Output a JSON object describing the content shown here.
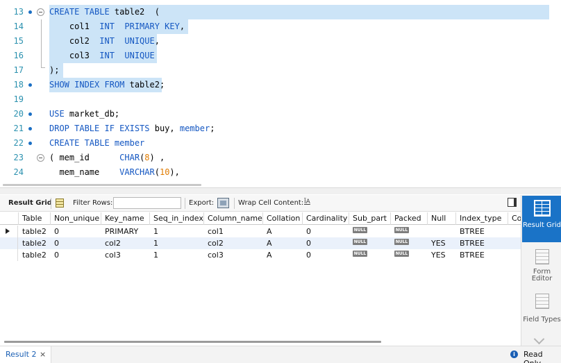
{
  "editor": {
    "lines": [
      {
        "n": "13",
        "bp": true,
        "segs": [
          [
            "kw",
            "CREATE TABLE "
          ],
          [
            "id",
            "table2  ("
          ]
        ]
      },
      {
        "n": "14",
        "bp": false,
        "segs": [
          [
            "id",
            "    col1  "
          ],
          [
            "kw",
            "INT  PRIMARY KEY"
          ],
          [
            "id",
            ","
          ]
        ]
      },
      {
        "n": "15",
        "bp": false,
        "segs": [
          [
            "id",
            "    col2  "
          ],
          [
            "kw",
            "INT  UNIQUE"
          ],
          [
            "id",
            ","
          ]
        ]
      },
      {
        "n": "16",
        "bp": false,
        "segs": [
          [
            "id",
            "    col3  "
          ],
          [
            "kw",
            "INT  UNIQUE"
          ]
        ]
      },
      {
        "n": "17",
        "bp": false,
        "segs": [
          [
            "id",
            ");"
          ]
        ]
      },
      {
        "n": "18",
        "bp": true,
        "segs": [
          [
            "kw",
            "SHOW INDEX FROM "
          ],
          [
            "id",
            "table2;"
          ]
        ]
      },
      {
        "n": "19",
        "bp": false,
        "segs": []
      },
      {
        "n": "20",
        "bp": true,
        "segs": [
          [
            "kw",
            "USE "
          ],
          [
            "id",
            "market_db;"
          ]
        ]
      },
      {
        "n": "21",
        "bp": true,
        "segs": [
          [
            "kw",
            "DROP TABLE IF EXISTS "
          ],
          [
            "id",
            "buy, "
          ],
          [
            "kw",
            "member"
          ],
          [
            "id",
            ";"
          ]
        ]
      },
      {
        "n": "22",
        "bp": true,
        "segs": [
          [
            "kw",
            "CREATE TABLE member"
          ]
        ]
      },
      {
        "n": "23",
        "bp": false,
        "segs": [
          [
            "id",
            "( mem_id      "
          ],
          [
            "kw",
            "CHAR"
          ],
          [
            "id",
            "("
          ],
          [
            "num",
            "8"
          ],
          [
            "id",
            ") ,"
          ]
        ]
      },
      {
        "n": "24",
        "bp": false,
        "segs": [
          [
            "id",
            "  mem_name    "
          ],
          [
            "kw",
            "VARCHAR"
          ],
          [
            "id",
            "("
          ],
          [
            "num",
            "10"
          ],
          [
            "id",
            "),"
          ]
        ]
      }
    ]
  },
  "toolbar": {
    "result_grid_label": "Result Grid",
    "filter_rows_label": "Filter Rows:",
    "filter_rows_value": "",
    "export_label": "Export:",
    "wrap_label": "Wrap Cell Content:",
    "wrap_icon": "ĪA"
  },
  "grid": {
    "columns": [
      "Table",
      "Non_unique",
      "Key_name",
      "Seq_in_index",
      "Column_name",
      "Collation",
      "Cardinality",
      "Sub_part",
      "Packed",
      "Null",
      "Index_type",
      "Co"
    ],
    "rows": [
      [
        "table2",
        "0",
        "PRIMARY",
        "1",
        "col1",
        "A",
        "0",
        "NULL",
        "NULL",
        "",
        "BTREE"
      ],
      [
        "table2",
        "0",
        "col2",
        "1",
        "col2",
        "A",
        "0",
        "NULL",
        "NULL",
        "YES",
        "BTREE"
      ],
      [
        "table2",
        "0",
        "col3",
        "1",
        "col3",
        "A",
        "0",
        "NULL",
        "NULL",
        "YES",
        "BTREE"
      ]
    ]
  },
  "side_panel": {
    "result_grid": "Result Grid",
    "form_editor": "Form Editor",
    "field_types": "Field Types"
  },
  "bottom": {
    "tab_label": "Result 2",
    "close": "×",
    "status": "Read Only"
  },
  "icons": [
    "breakpoint-dot-icon",
    "fold-collapse-icon",
    "grid-icon",
    "export-icon",
    "wrap-cell-icon",
    "panel-toggle-icon",
    "result-grid-icon",
    "form-editor-icon",
    "field-types-icon",
    "chevron-down-icon",
    "info-icon",
    "row-pointer-icon"
  ]
}
